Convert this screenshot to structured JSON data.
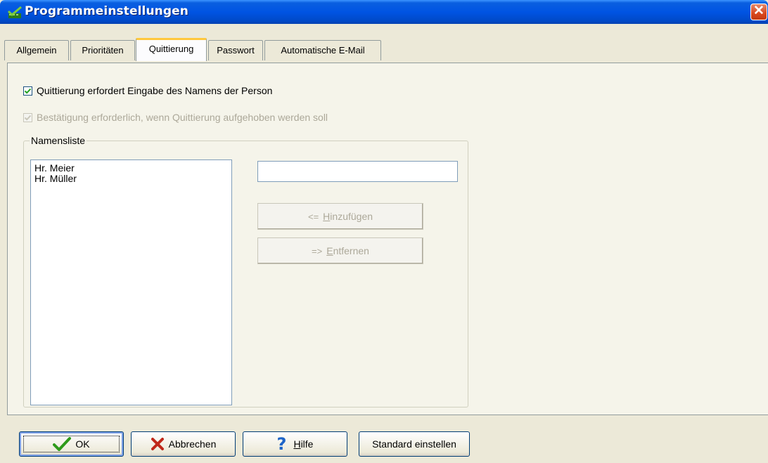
{
  "window": {
    "title": "Programmeinstellungen",
    "close_label": "✕"
  },
  "tabs": [
    {
      "label": "Allgemein"
    },
    {
      "label": "Prioritäten"
    },
    {
      "label": "Quittierung"
    },
    {
      "label": "Passwort"
    },
    {
      "label": "Automatische E-Mail"
    }
  ],
  "active_tab": "Quittierung",
  "options": {
    "require_name": {
      "label": "Quittierung erfordert Eingabe des Namens der Person",
      "checked": true,
      "enabled": true
    },
    "confirm_revoke": {
      "label": "Bestätigung erforderlich, wenn Quittierung aufgehoben werden soll",
      "checked": true,
      "enabled": false
    }
  },
  "namensliste": {
    "label": "Namensliste",
    "names": [
      "Hr. Meier",
      "Hr. Müller"
    ],
    "input_value": "",
    "add": {
      "prefix": "H",
      "rest": "inzufügen",
      "arrow": "<="
    },
    "remove": {
      "prefix": "E",
      "rest": "ntfernen",
      "arrow": "=>"
    }
  },
  "footer": {
    "ok": "OK",
    "cancel": "Abbrechen",
    "help_prefix": "H",
    "help_rest": "ilfe",
    "defaults": "Standard einstellen"
  },
  "colors": {
    "titlebar": "#0054e3",
    "active_tab_accent": "#ffc83c",
    "close_button": "#d9481d",
    "ok_check": "#2e9a1a",
    "cancel_x": "#c0281a",
    "help_q": "#1e64c8"
  }
}
